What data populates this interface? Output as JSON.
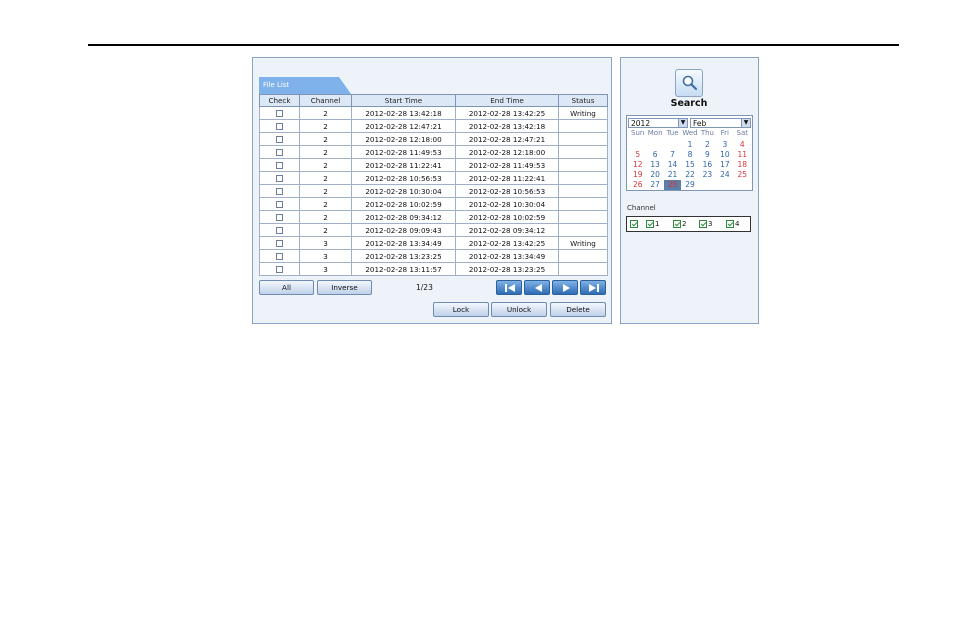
{
  "tab": {
    "label": "File List"
  },
  "table": {
    "headers": [
      "Check",
      "Channel",
      "Start Time",
      "End Time",
      "Status"
    ],
    "rows": [
      {
        "channel": "2",
        "start": "2012-02-28 13:42:18",
        "end": "2012-02-28 13:42:25",
        "status": "Writing"
      },
      {
        "channel": "2",
        "start": "2012-02-28 12:47:21",
        "end": "2012-02-28 13:42:18",
        "status": ""
      },
      {
        "channel": "2",
        "start": "2012-02-28 12:18:00",
        "end": "2012-02-28 12:47:21",
        "status": ""
      },
      {
        "channel": "2",
        "start": "2012-02-28 11:49:53",
        "end": "2012-02-28 12:18:00",
        "status": ""
      },
      {
        "channel": "2",
        "start": "2012-02-28 11:22:41",
        "end": "2012-02-28 11:49:53",
        "status": ""
      },
      {
        "channel": "2",
        "start": "2012-02-28 10:56:53",
        "end": "2012-02-28 11:22:41",
        "status": ""
      },
      {
        "channel": "2",
        "start": "2012-02-28 10:30:04",
        "end": "2012-02-28 10:56:53",
        "status": ""
      },
      {
        "channel": "2",
        "start": "2012-02-28 10:02:59",
        "end": "2012-02-28 10:30:04",
        "status": ""
      },
      {
        "channel": "2",
        "start": "2012-02-28 09:34:12",
        "end": "2012-02-28 10:02:59",
        "status": ""
      },
      {
        "channel": "2",
        "start": "2012-02-28 09:09:43",
        "end": "2012-02-28 09:34:12",
        "status": ""
      },
      {
        "channel": "3",
        "start": "2012-02-28 13:34:49",
        "end": "2012-02-28 13:42:25",
        "status": "Writing"
      },
      {
        "channel": "3",
        "start": "2012-02-28 13:23:25",
        "end": "2012-02-28 13:34:49",
        "status": ""
      },
      {
        "channel": "3",
        "start": "2012-02-28 13:11:57",
        "end": "2012-02-28 13:23:25",
        "status": ""
      }
    ]
  },
  "buttons": {
    "all": "All",
    "inverse": "Inverse",
    "lock": "Lock",
    "unlock": "Unlock",
    "delete": "Delete"
  },
  "pagination": {
    "page": "1/23"
  },
  "search": {
    "label": "Search"
  },
  "calendar": {
    "year": "2012",
    "month": "Feb",
    "weekdays": [
      "Sun",
      "Mon",
      "Tue",
      "Wed",
      "Thu",
      "Fri",
      "Sat"
    ],
    "days": [
      "",
      "",
      "",
      "1",
      "2",
      "3",
      "4",
      "5",
      "6",
      "7",
      "8",
      "9",
      "10",
      "11",
      "12",
      "13",
      "14",
      "15",
      "16",
      "17",
      "18",
      "19",
      "20",
      "21",
      "22",
      "23",
      "24",
      "25",
      "26",
      "27",
      "28",
      "29"
    ],
    "selected_day": "28",
    "weekend_color": "#d9343a",
    "weekday_color": "#2f64a8"
  },
  "channel": {
    "label": "Channel",
    "items": [
      {
        "label": "",
        "checked": true
      },
      {
        "label": "1",
        "checked": true
      },
      {
        "label": "2",
        "checked": true
      },
      {
        "label": "3",
        "checked": true
      },
      {
        "label": "4",
        "checked": true
      }
    ]
  },
  "colors": {
    "tab": "#7fb1ea",
    "panel_bg": "#eef3fa",
    "border": "#8aa4c4"
  }
}
